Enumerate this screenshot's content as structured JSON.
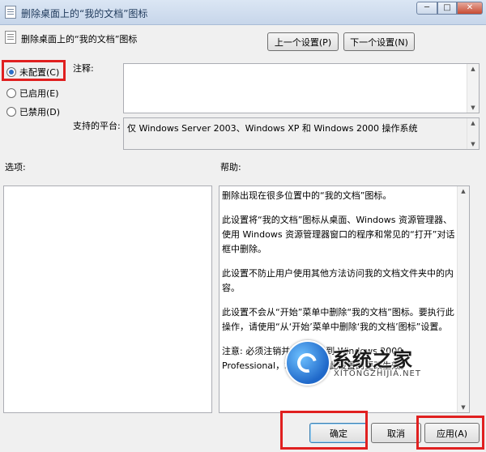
{
  "window": {
    "title": "删除桌面上的“我的文档”图标",
    "min_label": "─",
    "max_label": "□",
    "close_label": "✕"
  },
  "header": {
    "title": "删除桌面上的“我的文档”图标",
    "prev_button": "上一个设置(P)",
    "next_button": "下一个设置(N)"
  },
  "state": {
    "options": [
      {
        "label": "未配置(C)",
        "checked": true
      },
      {
        "label": "已启用(E)",
        "checked": false
      },
      {
        "label": "已禁用(D)",
        "checked": false
      }
    ]
  },
  "comment": {
    "label": "注释:",
    "value": ""
  },
  "supported": {
    "label": "支持的平台:",
    "value": "仅 Windows Server 2003、Windows XP 和 Windows 2000 操作系统"
  },
  "options_label": "选项:",
  "help_label": "帮助:",
  "help": {
    "paragraphs": [
      "删除出现在很多位置中的“我的文档”图标。",
      "此设置将“我的文档”图标从桌面、Windows 资源管理器、使用 Windows 资源管理器窗口的程序和常见的“打开”对话框中删除。",
      "此设置不防止用户使用其他方法访问我的文档文件夹中的内容。",
      "此设置不会从“开始”菜单中删除“我的文档”图标。要执行此操作，请使用“从‘开始’菜单中删除‘我的文档’图标”设置。",
      "注意: 必须注销并重新登录到 Windows 2000 Professional，才能使对于此设置的更改生效。"
    ]
  },
  "watermark": {
    "name_cn": "系统之家",
    "name_en": "XITONGZHIJIA.NET"
  },
  "footer": {
    "ok": "确定",
    "cancel": "取消",
    "apply": "应用(A)"
  },
  "colors": {
    "highlight": "#e02020",
    "radio_dot": "#2a6fc9"
  }
}
